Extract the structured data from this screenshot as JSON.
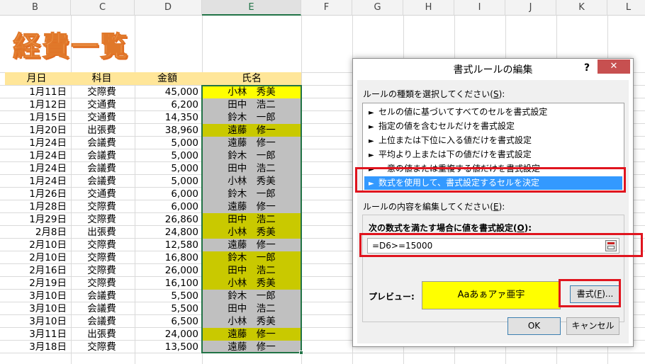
{
  "columns": [
    "B",
    "C",
    "D",
    "E",
    "F",
    "G",
    "H",
    "I",
    "J",
    "K",
    "L"
  ],
  "sheet_title": "経費一覧",
  "headers": {
    "date": "月日",
    "category": "科目",
    "amount": "金額",
    "name": "氏名"
  },
  "rows": [
    {
      "date": "1月11日",
      "category": "交際費",
      "amount": "45,000",
      "name": "小林　秀美",
      "fill": "yellow"
    },
    {
      "date": "1月12日",
      "category": "交通費",
      "amount": "6,200",
      "name": "田中　浩二",
      "fill": "gray"
    },
    {
      "date": "1月15日",
      "category": "交通費",
      "amount": "14,350",
      "name": "鈴木　一郎",
      "fill": "gray"
    },
    {
      "date": "1月20日",
      "category": "出張費",
      "amount": "38,960",
      "name": "遠藤　修一",
      "fill": "olive"
    },
    {
      "date": "1月24日",
      "category": "会議費",
      "amount": "5,000",
      "name": "遠藤　修一",
      "fill": "gray"
    },
    {
      "date": "1月24日",
      "category": "会議費",
      "amount": "5,000",
      "name": "鈴木　一郎",
      "fill": "gray"
    },
    {
      "date": "1月24日",
      "category": "会議費",
      "amount": "5,000",
      "name": "田中　浩二",
      "fill": "gray"
    },
    {
      "date": "1月24日",
      "category": "会議費",
      "amount": "5,000",
      "name": "小林　秀美",
      "fill": "gray"
    },
    {
      "date": "1月26日",
      "category": "交通費",
      "amount": "6,000",
      "name": "鈴木　一郎",
      "fill": "gray"
    },
    {
      "date": "1月28日",
      "category": "交際費",
      "amount": "6,000",
      "name": "遠藤　修一",
      "fill": "gray"
    },
    {
      "date": "1月29日",
      "category": "交際費",
      "amount": "26,860",
      "name": "田中　浩二",
      "fill": "olive"
    },
    {
      "date": "2月8日",
      "category": "出張費",
      "amount": "24,800",
      "name": "小林　秀美",
      "fill": "olive"
    },
    {
      "date": "2月10日",
      "category": "交際費",
      "amount": "12,580",
      "name": "遠藤　修一",
      "fill": "gray"
    },
    {
      "date": "2月10日",
      "category": "交際費",
      "amount": "16,800",
      "name": "鈴木　一郎",
      "fill": "olive"
    },
    {
      "date": "2月16日",
      "category": "交際費",
      "amount": "26,000",
      "name": "田中　浩二",
      "fill": "olive"
    },
    {
      "date": "2月19日",
      "category": "交際費",
      "amount": "16,100",
      "name": "小林　秀美",
      "fill": "olive"
    },
    {
      "date": "3月10日",
      "category": "会議費",
      "amount": "5,500",
      "name": "鈴木　一郎",
      "fill": "gray"
    },
    {
      "date": "3月10日",
      "category": "会議費",
      "amount": "5,500",
      "name": "田中　浩二",
      "fill": "gray"
    },
    {
      "date": "3月10日",
      "category": "会議費",
      "amount": "6,500",
      "name": "小林　秀美",
      "fill": "gray"
    },
    {
      "date": "3月11日",
      "category": "出張費",
      "amount": "24,000",
      "name": "遠藤　修一",
      "fill": "olive"
    },
    {
      "date": "3月18日",
      "category": "交際費",
      "amount": "13,500",
      "name": "遠藤　修一",
      "fill": "gray"
    }
  ],
  "dialog": {
    "title": "書式ルールの編集",
    "help_label": "?",
    "close_label": "✕",
    "rule_type_label": "ルールの種類を選択してください(",
    "rule_type_key": "S",
    "rule_type_suffix": "):",
    "rule_types": [
      "セルの値に基づいてすべてのセルを書式設定",
      "指定の値を含むセルだけを書式設定",
      "上位または下位に入る値だけを書式設定",
      "平均より上または下の値だけを書式設定",
      "一意の値または重複する値だけを書式設定",
      "数式を使用して、書式設定するセルを決定"
    ],
    "selected_rule_index": 5,
    "edit_label": "ルールの内容を編集してください(",
    "edit_key": "E",
    "edit_suffix": "):",
    "formula_label": "次の数式を満たす場合に値を書式設定(",
    "formula_key": "O",
    "formula_suffix": "):",
    "formula_value": "=D6>=15000",
    "preview_label": "プレビュー:",
    "preview_text": "Aaあぁアァ亜宇",
    "format_button": "書式(",
    "format_key": "F",
    "format_suffix": ")...",
    "ok_button": "OK",
    "cancel_button": "キャンセル"
  },
  "colors": {
    "highlight_yellow": "#ffff00",
    "highlight_olive": "#c9c900",
    "gray_fill": "#c0c0c0",
    "header_fill": "#ffe699",
    "title_orange": "#f4a460",
    "callout_red": "#e0141e"
  }
}
